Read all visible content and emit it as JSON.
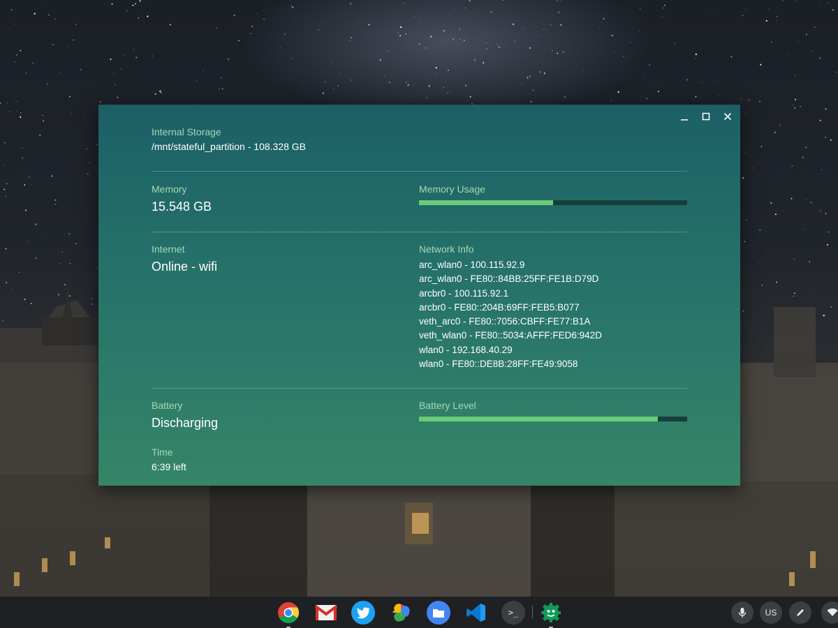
{
  "storage": {
    "label": "Internal Storage",
    "value": "/mnt/stateful_partition - 108.328 GB"
  },
  "memory": {
    "label": "Memory",
    "value": "15.548 GB",
    "usage_label": "Memory Usage",
    "usage_fraction": 0.5
  },
  "internet": {
    "label": "Internet",
    "value": "Online - wifi"
  },
  "network": {
    "label": "Network Info",
    "items": [
      "arc_wlan0 - 100.115.92.9",
      "arc_wlan0 - FE80::84BB:25FF:FE1B:D79D",
      "arcbr0 - 100.115.92.1",
      "arcbr0 - FE80::204B:69FF:FEB5:B077",
      "veth_arc0 - FE80::7056:CBFF:FE77:B1A",
      "veth_wlan0 - FE80::5034:AFFF:FED6:942D",
      "wlan0 - 192.168.40.29",
      "wlan0 - FE80::DE8B:28FF:FE49:9058"
    ]
  },
  "battery": {
    "label": "Battery",
    "value": "Discharging",
    "level_label": "Battery Level",
    "level_fraction": 0.89
  },
  "time": {
    "label": "Time",
    "value": "6:39 left"
  },
  "shelf": {
    "apps": [
      {
        "name": "chrome-icon"
      },
      {
        "name": "gmail-icon"
      },
      {
        "name": "twitter-icon"
      },
      {
        "name": "google-photos-icon"
      },
      {
        "name": "files-icon"
      },
      {
        "name": "vscode-icon"
      },
      {
        "name": "terminal-icon",
        "glyph": ">_"
      },
      {
        "name": "system-info-app-icon"
      }
    ],
    "keyboard_layout": "US"
  },
  "colors": {
    "window_top": "#1c5f66",
    "window_bottom": "#358568",
    "label_green": "#a6d8b3",
    "bar_fill": "#6bc97a",
    "bar_track": "#163f3c"
  }
}
